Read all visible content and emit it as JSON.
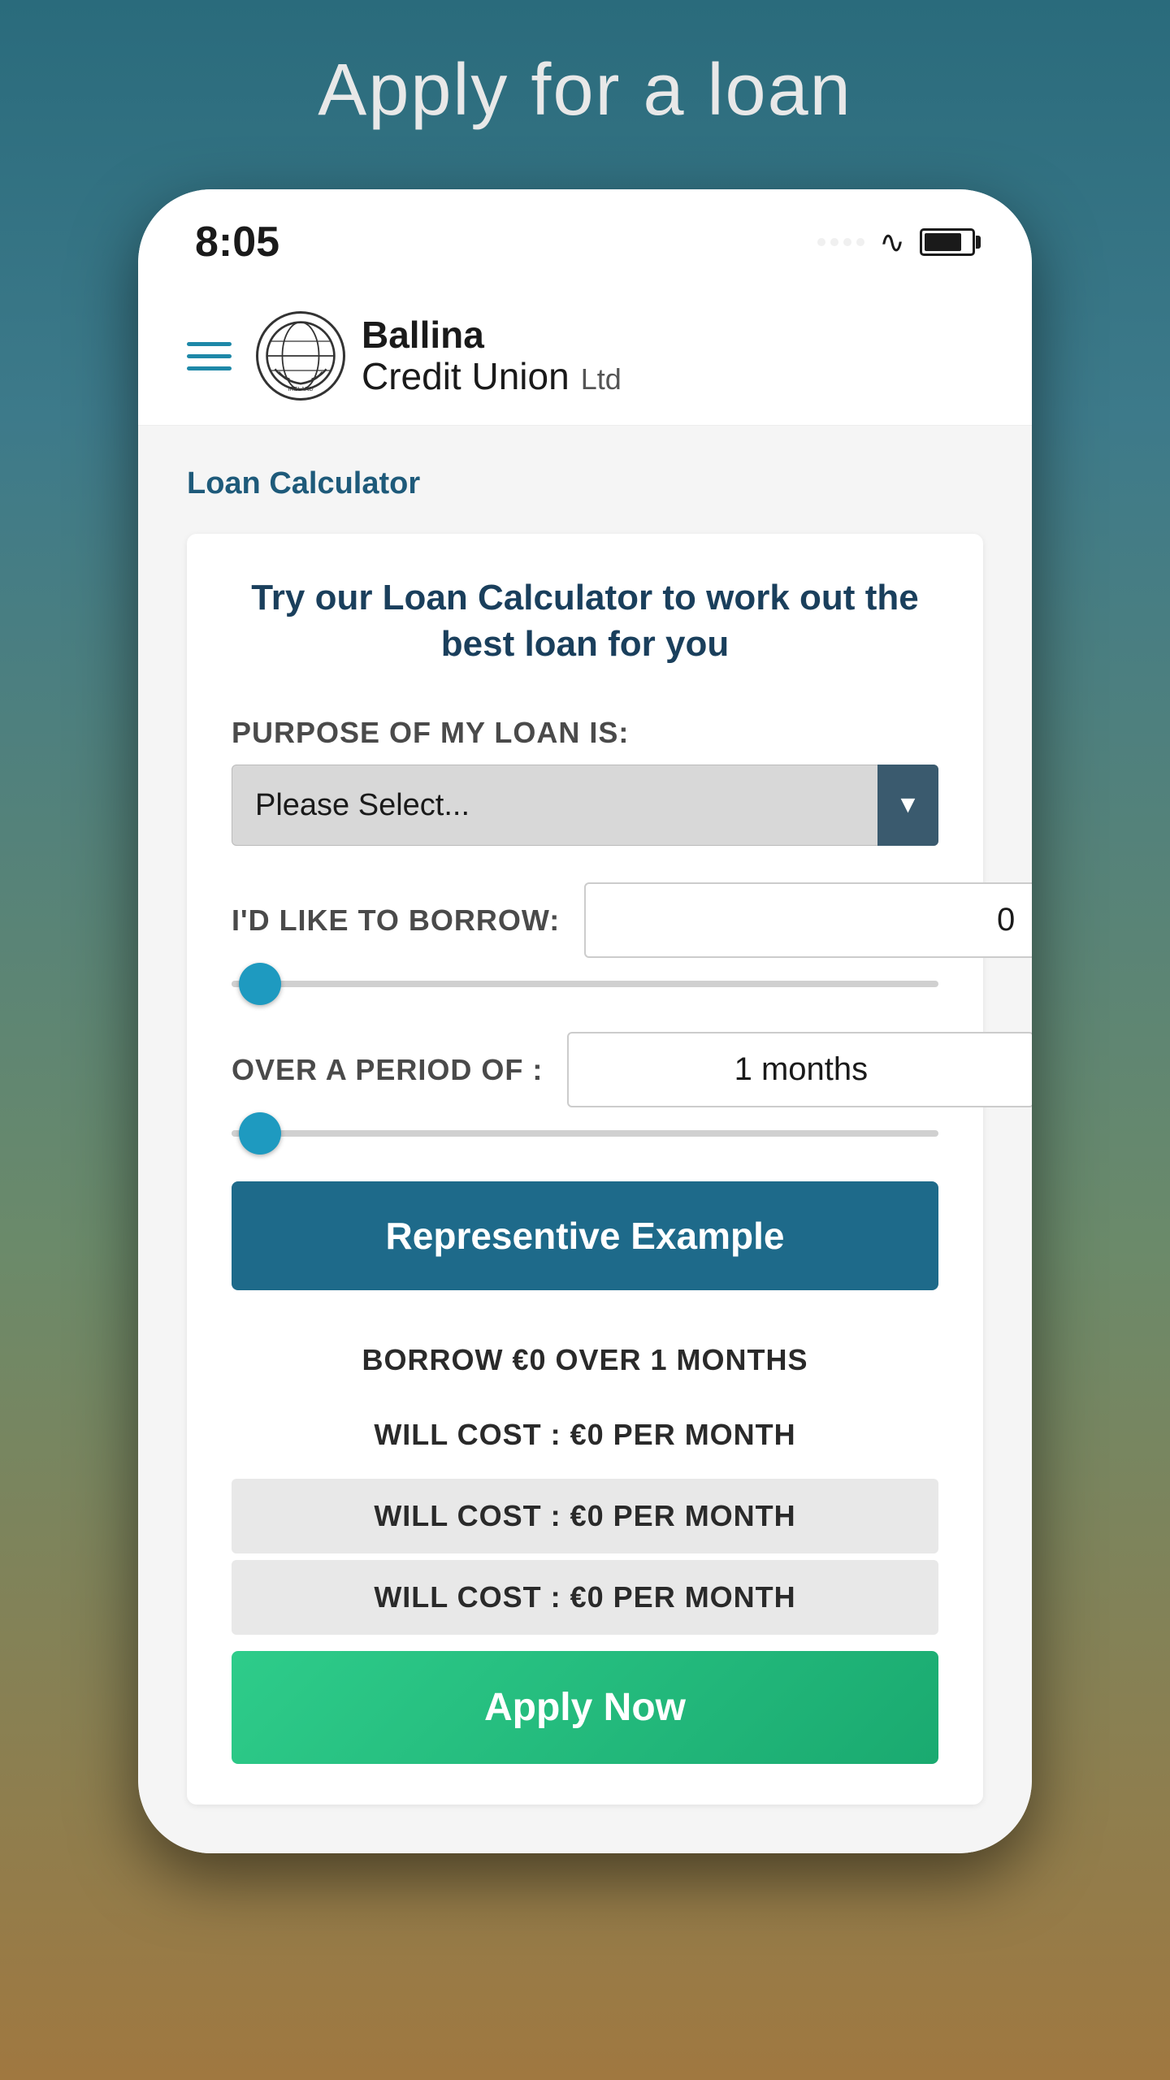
{
  "page": {
    "title": "Apply for a loan",
    "background": "linear-gradient(180deg, #2a6b7c 0%, #3d7a8a 20%, #6b8a6a 60%, #a07840 100%)"
  },
  "statusBar": {
    "time": "8:05"
  },
  "header": {
    "brand_line1": "Ballina",
    "brand_line2": "Credit Union",
    "brand_ltd": "Ltd"
  },
  "calculator": {
    "section_label": "Loan Calculator",
    "card_title": "Try our Loan Calculator to work out the\nbest loan for you",
    "purpose_label": "PURPOSE OF MY LOAN IS:",
    "purpose_placeholder": "Please Select...",
    "borrow_label": "I'D LIKE TO BORROW:",
    "borrow_value": "0",
    "period_label": "OVER A PERIOD OF :",
    "period_value": "1 months",
    "rep_example_btn": "Representive Example",
    "summary1": "BORROW €0 OVER 1 MONTHS",
    "summary2": "WILL COST : €0 PER MONTH",
    "summary3": "WILL COST : €0 PER MONTH",
    "summary4": "WILL COST : €0 PER MONTH",
    "apply_btn": "Apply Now"
  }
}
